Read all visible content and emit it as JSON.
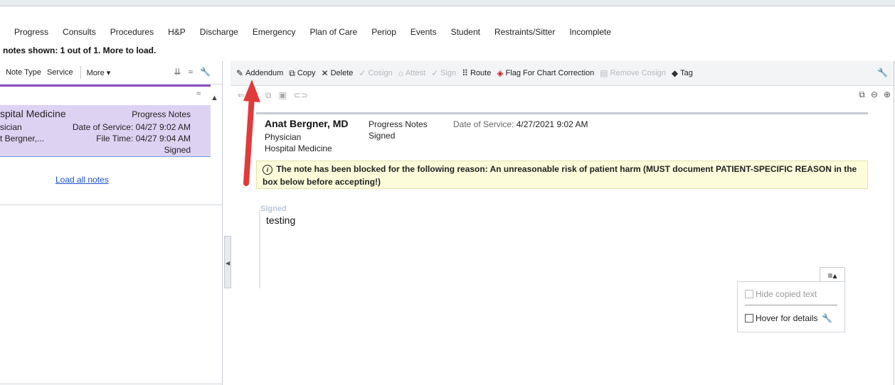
{
  "tabs": [
    "Progress",
    "Consults",
    "Procedures",
    "H&P",
    "Discharge",
    "Emergency",
    "Plan of Care",
    "Periop",
    "Events",
    "Student",
    "Restraints/Sitter",
    "Incomplete"
  ],
  "notes_shown": "notes shown: 1 out of 1.  More to load.",
  "left_toolbar": {
    "note_type": "Note Type",
    "service": "Service",
    "more": "More ▾"
  },
  "note_card": {
    "service": "spital Medicine",
    "type": "Progress Notes",
    "role": "sician",
    "date_of_service": "Date of Service: 04/27 9:02 AM",
    "author": "t Bergner,...",
    "file_time": "File Time: 04/27 9:04 AM",
    "status": "Signed"
  },
  "load_all": "Load all notes",
  "toolbar": {
    "addendum": "Addendum",
    "copy": "Copy",
    "delete": "Delete",
    "cosign": "Cosign",
    "attest": "Attest",
    "sign": "Sign",
    "route": "Route",
    "flag": "Flag For Chart Correction",
    "remove_cosign": "Remove Cosign",
    "tag": "Tag"
  },
  "note": {
    "author": "Anat Bergner, MD",
    "role": "Physician",
    "department": "Hospital Medicine",
    "type": "Progress Notes",
    "status": "Signed",
    "dos_label": "Date of Service:",
    "dos_value": "4/27/2021  9:02 AM",
    "warning": "The note has been blocked for the following reason: An unreasonable risk of patient harm (MUST document PATIENT-SPECIFIC REASON in the box below before accepting!)",
    "watermark": "Signed",
    "body": "testing"
  },
  "options": {
    "hide_copied": "Hide copied text",
    "hover_details": "Hover for details"
  },
  "colors": {
    "selected_card": "#ded2f3",
    "accent_bar": "#8c4fc0",
    "link": "#1a55c8",
    "flag": "#c41a1a",
    "arrow": "#e03a3a",
    "warning_bg": "#fcfcdb"
  }
}
